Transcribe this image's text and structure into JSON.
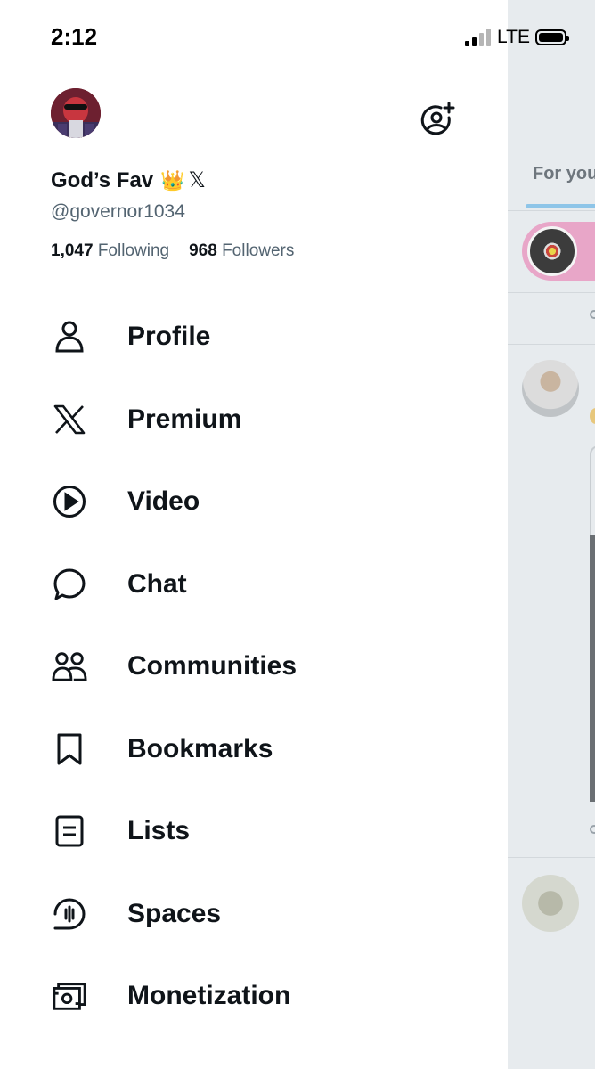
{
  "status_bar": {
    "time": "2:12",
    "network": "LTE"
  },
  "profile": {
    "display_name": "God’s Fav",
    "crown_emoji": "👑",
    "x_badge": "𝕏",
    "handle": "@governor1034",
    "following_count": "1,047",
    "following_label": "Following",
    "followers_count": "968",
    "followers_label": "Followers"
  },
  "menu": {
    "items": [
      {
        "label": "Profile",
        "icon": "person-icon"
      },
      {
        "label": "Premium",
        "icon": "x-logo-icon"
      },
      {
        "label": "Video",
        "icon": "play-circle-icon"
      },
      {
        "label": "Chat",
        "icon": "chat-bubble-icon"
      },
      {
        "label": "Communities",
        "icon": "communities-icon"
      },
      {
        "label": "Bookmarks",
        "icon": "bookmark-icon"
      },
      {
        "label": "Lists",
        "icon": "list-icon"
      },
      {
        "label": "Spaces",
        "icon": "spaces-icon"
      },
      {
        "label": "Monetization",
        "icon": "money-icon"
      }
    ]
  },
  "background_feed": {
    "tab_label": "For you"
  },
  "colors": {
    "text": "#0f1419",
    "secondary": "#536471",
    "feed_bg": "#e7ebee"
  }
}
